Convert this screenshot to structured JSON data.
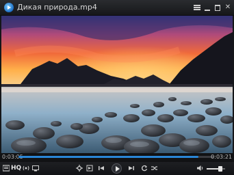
{
  "window": {
    "title": "Дикая природа.mp4",
    "icons": {
      "app": "player-logo-icon",
      "menu": "menu-icon",
      "minimize": "minimize-icon",
      "maximize": "maximize-icon",
      "close": "close-icon"
    }
  },
  "playback": {
    "current_time": "0:03:05",
    "duration": "0:03:21",
    "progress": 0.92
  },
  "controls": {
    "quality_label": "HQ",
    "volume_level": 0.75,
    "icons": [
      "playlist-icon",
      "hq-toggle",
      "broadcast-icon",
      "subtitles-icon",
      "settings-icon",
      "frame-step-icon",
      "previous-icon",
      "play-icon",
      "next-icon",
      "repeat-icon",
      "shuffle-icon",
      "volume-icon"
    ]
  },
  "colors": {
    "accent": "#2a86d7",
    "background": "#151619"
  }
}
